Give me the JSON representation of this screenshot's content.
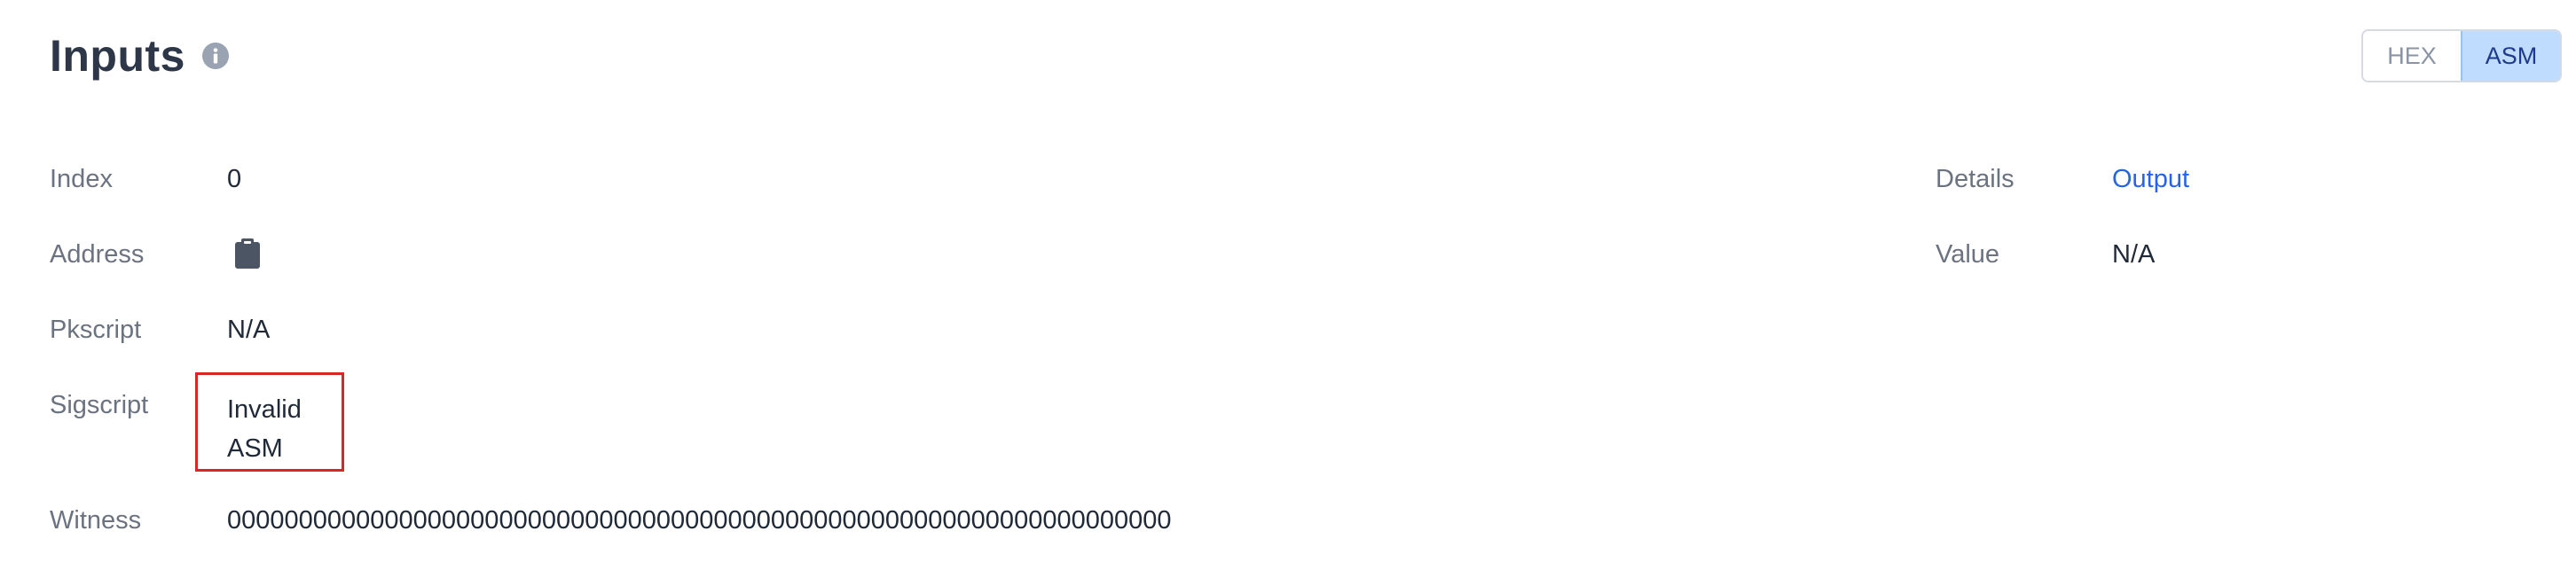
{
  "header": {
    "title": "Inputs",
    "info_icon": "info-circle-icon"
  },
  "view_toggle": {
    "options": [
      "HEX",
      "ASM"
    ],
    "selected": "ASM"
  },
  "left_fields": {
    "index": {
      "label": "Index",
      "value": "0"
    },
    "address": {
      "label": "Address",
      "icon": "clipboard-icon"
    },
    "pkscript": {
      "label": "Pkscript",
      "value": "N/A"
    },
    "sigscript": {
      "label": "Sigscript",
      "value": "Invalid ASM"
    },
    "witness": {
      "label": "Witness",
      "value": "000000000000000000000000000000000000000000000000000000000000000000"
    }
  },
  "right_fields": {
    "details": {
      "label": "Details",
      "value": "Output"
    },
    "value": {
      "label": "Value",
      "value": "N/A"
    }
  },
  "colors": {
    "title": "#2d3748",
    "label": "#6b7280",
    "link": "#2563eb",
    "toggle_active_bg": "#bfdbfe",
    "highlight_box": "#dc2626"
  }
}
